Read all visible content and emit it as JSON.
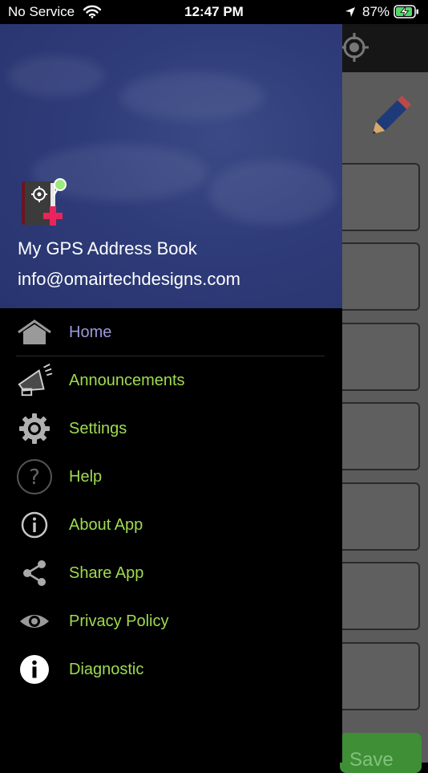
{
  "status_bar": {
    "carrier": "No Service",
    "time": "12:47 PM",
    "battery_percent": "87%"
  },
  "drawer": {
    "app_name": "My GPS Address Book",
    "email": "info@omairtechdesigns.com",
    "menu": [
      {
        "label": "Home",
        "icon": "home-icon",
        "active": true
      },
      {
        "label": "Announcements",
        "icon": "megaphone-icon"
      },
      {
        "label": "Settings",
        "icon": "gear-icon"
      },
      {
        "label": "Help",
        "icon": "help-icon"
      },
      {
        "label": "About App",
        "icon": "info-outline-icon"
      },
      {
        "label": "Share App",
        "icon": "share-icon"
      },
      {
        "label": "Privacy Policy",
        "icon": "eye-icon"
      },
      {
        "label": "Diagnostic",
        "icon": "info-filled-icon"
      }
    ]
  },
  "background": {
    "save_label": "Save"
  },
  "colors": {
    "menu_text": "#9fdb4f",
    "active_text": "#9a9ad8",
    "header_bg": "#2f3c7a",
    "save_button": "#3f8f37"
  }
}
